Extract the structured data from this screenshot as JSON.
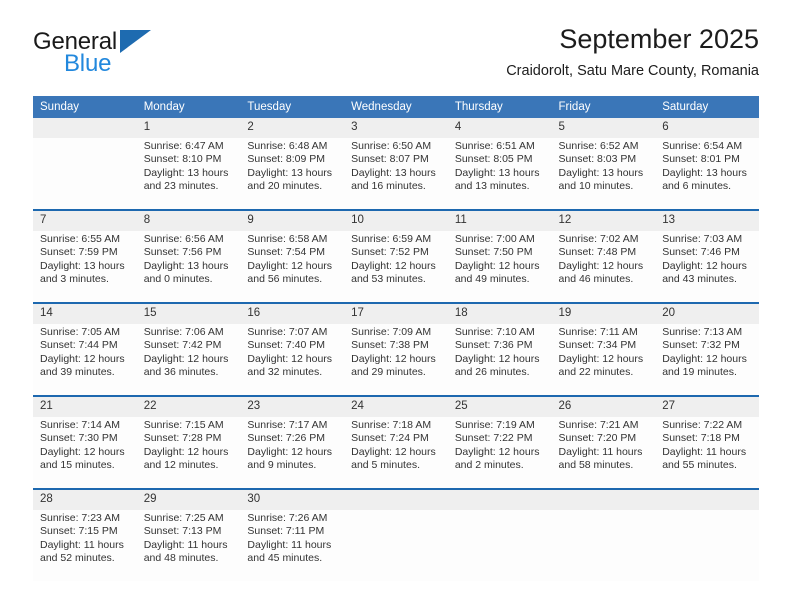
{
  "brand": {
    "name_top": "General",
    "name_bottom": "Blue",
    "accent_color": "#1e6bb0",
    "accent_color_light": "#2288dd"
  },
  "header": {
    "title": "September 2025",
    "subtitle": "Craidorolt, Satu Mare County, Romania"
  },
  "theme": {
    "header_row_bg": "#3a76b8",
    "week_separator": "#1d68af",
    "date_band_bg": "#efefef",
    "cell_bg": "#fdfdfd"
  },
  "weekday_headers": [
    "Sunday",
    "Monday",
    "Tuesday",
    "Wednesday",
    "Thursday",
    "Friday",
    "Saturday"
  ],
  "weeks": [
    {
      "days": [
        {
          "num": "",
          "sunrise": "",
          "sunset": "",
          "daylight_1": "",
          "daylight_2": ""
        },
        {
          "num": "1",
          "sunrise": "Sunrise: 6:47 AM",
          "sunset": "Sunset: 8:10 PM",
          "daylight_1": "Daylight: 13 hours",
          "daylight_2": "and 23 minutes."
        },
        {
          "num": "2",
          "sunrise": "Sunrise: 6:48 AM",
          "sunset": "Sunset: 8:09 PM",
          "daylight_1": "Daylight: 13 hours",
          "daylight_2": "and 20 minutes."
        },
        {
          "num": "3",
          "sunrise": "Sunrise: 6:50 AM",
          "sunset": "Sunset: 8:07 PM",
          "daylight_1": "Daylight: 13 hours",
          "daylight_2": "and 16 minutes."
        },
        {
          "num": "4",
          "sunrise": "Sunrise: 6:51 AM",
          "sunset": "Sunset: 8:05 PM",
          "daylight_1": "Daylight: 13 hours",
          "daylight_2": "and 13 minutes."
        },
        {
          "num": "5",
          "sunrise": "Sunrise: 6:52 AM",
          "sunset": "Sunset: 8:03 PM",
          "daylight_1": "Daylight: 13 hours",
          "daylight_2": "and 10 minutes."
        },
        {
          "num": "6",
          "sunrise": "Sunrise: 6:54 AM",
          "sunset": "Sunset: 8:01 PM",
          "daylight_1": "Daylight: 13 hours",
          "daylight_2": "and 6 minutes."
        }
      ]
    },
    {
      "days": [
        {
          "num": "7",
          "sunrise": "Sunrise: 6:55 AM",
          "sunset": "Sunset: 7:59 PM",
          "daylight_1": "Daylight: 13 hours",
          "daylight_2": "and 3 minutes."
        },
        {
          "num": "8",
          "sunrise": "Sunrise: 6:56 AM",
          "sunset": "Sunset: 7:56 PM",
          "daylight_1": "Daylight: 13 hours",
          "daylight_2": "and 0 minutes."
        },
        {
          "num": "9",
          "sunrise": "Sunrise: 6:58 AM",
          "sunset": "Sunset: 7:54 PM",
          "daylight_1": "Daylight: 12 hours",
          "daylight_2": "and 56 minutes."
        },
        {
          "num": "10",
          "sunrise": "Sunrise: 6:59 AM",
          "sunset": "Sunset: 7:52 PM",
          "daylight_1": "Daylight: 12 hours",
          "daylight_2": "and 53 minutes."
        },
        {
          "num": "11",
          "sunrise": "Sunrise: 7:00 AM",
          "sunset": "Sunset: 7:50 PM",
          "daylight_1": "Daylight: 12 hours",
          "daylight_2": "and 49 minutes."
        },
        {
          "num": "12",
          "sunrise": "Sunrise: 7:02 AM",
          "sunset": "Sunset: 7:48 PM",
          "daylight_1": "Daylight: 12 hours",
          "daylight_2": "and 46 minutes."
        },
        {
          "num": "13",
          "sunrise": "Sunrise: 7:03 AM",
          "sunset": "Sunset: 7:46 PM",
          "daylight_1": "Daylight: 12 hours",
          "daylight_2": "and 43 minutes."
        }
      ]
    },
    {
      "days": [
        {
          "num": "14",
          "sunrise": "Sunrise: 7:05 AM",
          "sunset": "Sunset: 7:44 PM",
          "daylight_1": "Daylight: 12 hours",
          "daylight_2": "and 39 minutes."
        },
        {
          "num": "15",
          "sunrise": "Sunrise: 7:06 AM",
          "sunset": "Sunset: 7:42 PM",
          "daylight_1": "Daylight: 12 hours",
          "daylight_2": "and 36 minutes."
        },
        {
          "num": "16",
          "sunrise": "Sunrise: 7:07 AM",
          "sunset": "Sunset: 7:40 PM",
          "daylight_1": "Daylight: 12 hours",
          "daylight_2": "and 32 minutes."
        },
        {
          "num": "17",
          "sunrise": "Sunrise: 7:09 AM",
          "sunset": "Sunset: 7:38 PM",
          "daylight_1": "Daylight: 12 hours",
          "daylight_2": "and 29 minutes."
        },
        {
          "num": "18",
          "sunrise": "Sunrise: 7:10 AM",
          "sunset": "Sunset: 7:36 PM",
          "daylight_1": "Daylight: 12 hours",
          "daylight_2": "and 26 minutes."
        },
        {
          "num": "19",
          "sunrise": "Sunrise: 7:11 AM",
          "sunset": "Sunset: 7:34 PM",
          "daylight_1": "Daylight: 12 hours",
          "daylight_2": "and 22 minutes."
        },
        {
          "num": "20",
          "sunrise": "Sunrise: 7:13 AM",
          "sunset": "Sunset: 7:32 PM",
          "daylight_1": "Daylight: 12 hours",
          "daylight_2": "and 19 minutes."
        }
      ]
    },
    {
      "days": [
        {
          "num": "21",
          "sunrise": "Sunrise: 7:14 AM",
          "sunset": "Sunset: 7:30 PM",
          "daylight_1": "Daylight: 12 hours",
          "daylight_2": "and 15 minutes."
        },
        {
          "num": "22",
          "sunrise": "Sunrise: 7:15 AM",
          "sunset": "Sunset: 7:28 PM",
          "daylight_1": "Daylight: 12 hours",
          "daylight_2": "and 12 minutes."
        },
        {
          "num": "23",
          "sunrise": "Sunrise: 7:17 AM",
          "sunset": "Sunset: 7:26 PM",
          "daylight_1": "Daylight: 12 hours",
          "daylight_2": "and 9 minutes."
        },
        {
          "num": "24",
          "sunrise": "Sunrise: 7:18 AM",
          "sunset": "Sunset: 7:24 PM",
          "daylight_1": "Daylight: 12 hours",
          "daylight_2": "and 5 minutes."
        },
        {
          "num": "25",
          "sunrise": "Sunrise: 7:19 AM",
          "sunset": "Sunset: 7:22 PM",
          "daylight_1": "Daylight: 12 hours",
          "daylight_2": "and 2 minutes."
        },
        {
          "num": "26",
          "sunrise": "Sunrise: 7:21 AM",
          "sunset": "Sunset: 7:20 PM",
          "daylight_1": "Daylight: 11 hours",
          "daylight_2": "and 58 minutes."
        },
        {
          "num": "27",
          "sunrise": "Sunrise: 7:22 AM",
          "sunset": "Sunset: 7:18 PM",
          "daylight_1": "Daylight: 11 hours",
          "daylight_2": "and 55 minutes."
        }
      ]
    },
    {
      "days": [
        {
          "num": "28",
          "sunrise": "Sunrise: 7:23 AM",
          "sunset": "Sunset: 7:15 PM",
          "daylight_1": "Daylight: 11 hours",
          "daylight_2": "and 52 minutes."
        },
        {
          "num": "29",
          "sunrise": "Sunrise: 7:25 AM",
          "sunset": "Sunset: 7:13 PM",
          "daylight_1": "Daylight: 11 hours",
          "daylight_2": "and 48 minutes."
        },
        {
          "num": "30",
          "sunrise": "Sunrise: 7:26 AM",
          "sunset": "Sunset: 7:11 PM",
          "daylight_1": "Daylight: 11 hours",
          "daylight_2": "and 45 minutes."
        },
        {
          "num": "",
          "sunrise": "",
          "sunset": "",
          "daylight_1": "",
          "daylight_2": ""
        },
        {
          "num": "",
          "sunrise": "",
          "sunset": "",
          "daylight_1": "",
          "daylight_2": ""
        },
        {
          "num": "",
          "sunrise": "",
          "sunset": "",
          "daylight_1": "",
          "daylight_2": ""
        },
        {
          "num": "",
          "sunrise": "",
          "sunset": "",
          "daylight_1": "",
          "daylight_2": ""
        }
      ]
    }
  ]
}
